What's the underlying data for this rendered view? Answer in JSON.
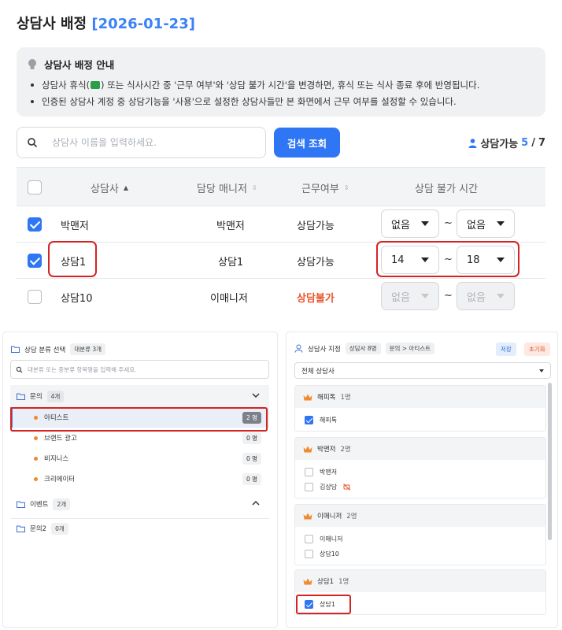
{
  "header": {
    "title": "상담사 배정",
    "date": "[2026-01-23]"
  },
  "notice": {
    "title": "상담사 배정 안내",
    "line1_a": "상담사 휴식(",
    "line1_b": ") 또는 식사시간 중 '근무 여부'와 '상담 불가 시간'을 변경하면, 휴식 또는 식사 종료 후에 반영됩니다.",
    "line2": "인증된 상담사 계정 중 상담기능을 '사용'으로 설정한 상담사들만 본 화면에서 근무 여부를 설정할 수 있습니다."
  },
  "search": {
    "placeholder": "상담사 이름을 입력하세요.",
    "button": "검색 조회"
  },
  "availability": {
    "label": "상담가능",
    "count": "5",
    "sep": "/",
    "total": "7"
  },
  "table": {
    "headers": {
      "agent": "상담사",
      "manager": "담당 매니저",
      "work": "근무여부",
      "unavailable": "상담 불가 시간"
    },
    "rows": [
      {
        "checked": true,
        "agent": "박맨저",
        "manager": "박맨저",
        "work": "상담가능",
        "from": "없음",
        "to": "없음",
        "disabled": false
      },
      {
        "checked": true,
        "agent": "상담1",
        "manager": "상담1",
        "work": "상담가능",
        "from": "14",
        "to": "18",
        "disabled": false
      },
      {
        "checked": false,
        "agent": "상담10",
        "manager": "이매니저",
        "work": "상담불가",
        "from": "없음",
        "to": "없음",
        "disabled": true
      }
    ],
    "tilde": "~"
  },
  "category_panel": {
    "title": "상담 분류 선택",
    "badge": "대분류 3개",
    "search_placeholder": "대분류 또는 중분류 항목명을 입력해 주세요.",
    "groups": [
      {
        "name": "문의",
        "count": "4개",
        "expanded": true,
        "items": [
          {
            "name": "아티스트",
            "count": "2 명",
            "selected": true
          },
          {
            "name": "브랜드 광고",
            "count": "0 명"
          },
          {
            "name": "비지니스",
            "count": "0 명"
          },
          {
            "name": "크리에이터",
            "count": "0 명"
          }
        ]
      },
      {
        "name": "이벤트",
        "count": "2개",
        "expanded": false
      },
      {
        "name": "문의2",
        "count": "0개",
        "expanded": false
      }
    ]
  },
  "assign_panel": {
    "title": "상담사 지정",
    "badge": "상담사 8명",
    "path": "문의 > 아티스트",
    "save": "저장",
    "reset": "초기화",
    "dropdown": "전체 상담사",
    "groups": [
      {
        "name": "해피톡",
        "count": "1명",
        "members": [
          {
            "name": "해피톡",
            "checked": true
          }
        ]
      },
      {
        "name": "박맨저",
        "count": "2명",
        "members": [
          {
            "name": "박맨저",
            "checked": false
          },
          {
            "name": "김상담",
            "checked": false,
            "off_icon": true
          }
        ]
      },
      {
        "name": "이매니저",
        "count": "2명",
        "members": [
          {
            "name": "이매니저",
            "checked": false
          },
          {
            "name": "상담10",
            "checked": false
          }
        ]
      },
      {
        "name": "상담1",
        "count": "1명",
        "members": [
          {
            "name": "상담1",
            "checked": true
          }
        ]
      }
    ]
  },
  "colors": {
    "accent": "#2f76f5",
    "highlight": "#d42323",
    "unavailable": "#e8552c",
    "crown": "#f08a2c"
  }
}
